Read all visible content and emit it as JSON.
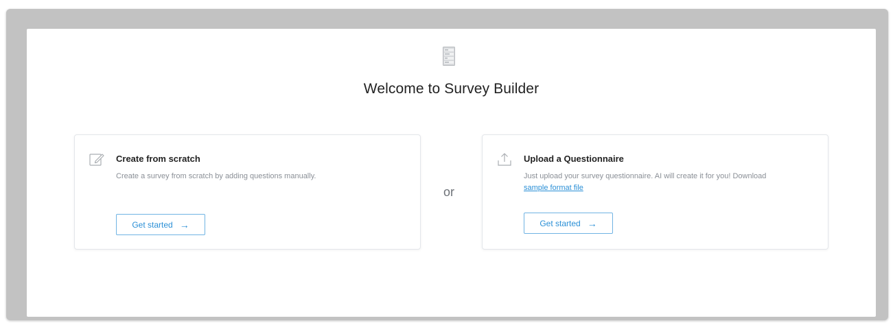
{
  "header": {
    "logo_icon": "stacked-forms-icon",
    "title": "Welcome to Survey Builder"
  },
  "divider_text": "or",
  "cards": [
    {
      "icon": "edit-icon",
      "title": "Create from scratch",
      "description": "Create a survey from scratch by adding questions manually.",
      "button_label": "Get started"
    },
    {
      "icon": "upload-icon",
      "title": "Upload a Questionnaire",
      "description": "Just upload your survey questionnaire. AI will create it for you! Download",
      "link_text": "sample format file",
      "button_label": "Get started"
    }
  ],
  "colors": {
    "accent": "#2a8fd6",
    "button_border": "#6fb3e3",
    "frame": "#c2c2c2"
  }
}
